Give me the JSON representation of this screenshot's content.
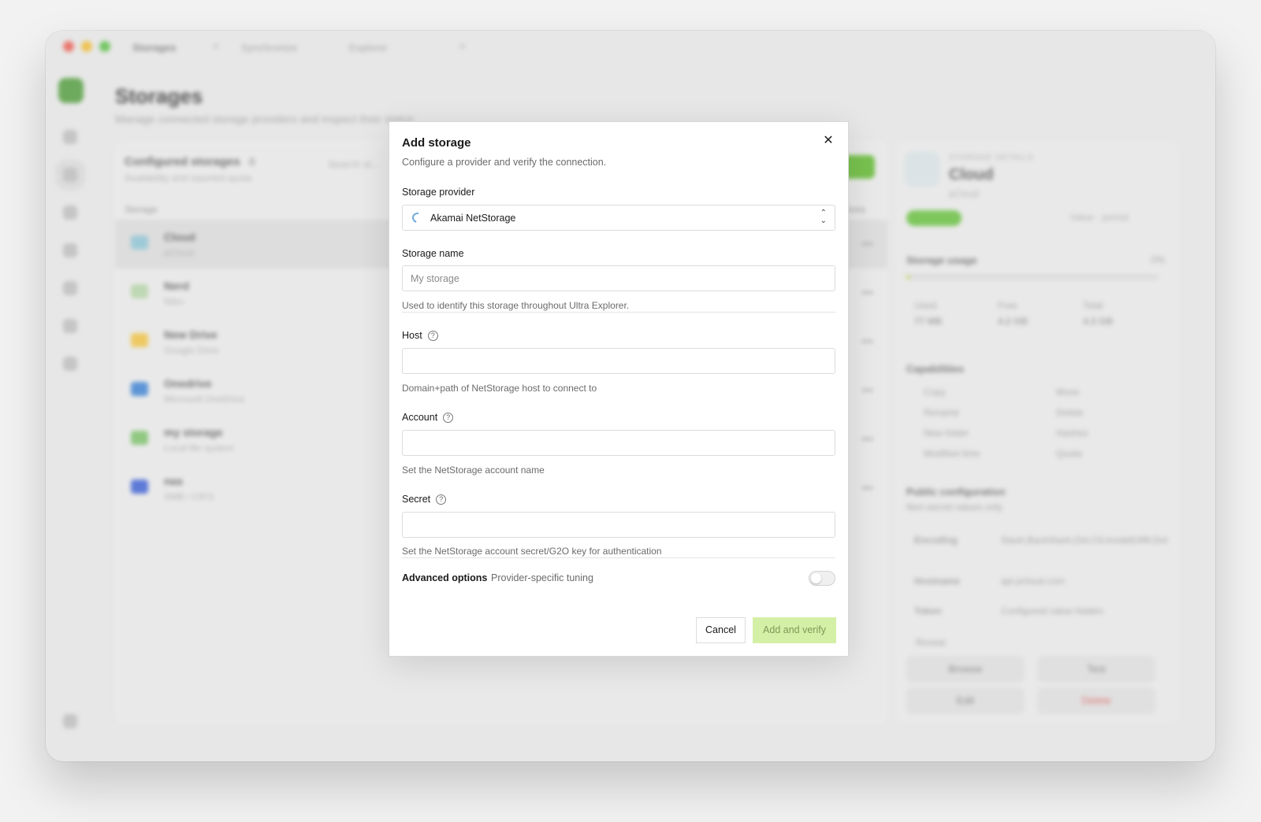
{
  "window": {
    "tabs": [
      "Storages",
      "Synchronize",
      "Explorer"
    ],
    "tab_close": "×"
  },
  "background": {
    "page_title": "Storages",
    "page_subtitle": "Manage connected storage providers and inspect their status",
    "list": {
      "title": "Configured storages",
      "count": "6",
      "subtitle": "Availability and reported quota",
      "search_placeholder": "Search st...",
      "col_storage": "Storage",
      "col_actions": "Actions",
      "rows": [
        {
          "name": "Cloud",
          "sub": "pCloud",
          "color": "#8ec6d8"
        },
        {
          "name": "Nerd",
          "sub": "Nitro",
          "color": "#b7d7a8"
        },
        {
          "name": "New Drive",
          "sub": "Google Drive",
          "color": "#f4c542"
        },
        {
          "name": "Onedrive",
          "sub": "Microsoft OneDrive",
          "color": "#3b82d6"
        },
        {
          "name": "my storage",
          "sub": "Local file system",
          "color": "#7cc36a"
        },
        {
          "name": "nas",
          "sub": "SMB / CIFS",
          "color": "#3a5fd6"
        }
      ],
      "row_menu": "•••"
    },
    "detail": {
      "eyebrow": "STORAGE DETAILS",
      "name": "Cloud",
      "sub": "pCloud",
      "meta": "Value · period",
      "usage_title": "Storage usage",
      "usage_pct": "0%",
      "usage_fraction": 0.01,
      "stats": [
        {
          "label": "Used",
          "value": "77 MB"
        },
        {
          "label": "Free",
          "value": "4.2 GB"
        },
        {
          "label": "Total",
          "value": "4.3 GB"
        }
      ],
      "cap_title": "Capabilities",
      "caps": [
        "Copy",
        "Move",
        "Rename",
        "Delete",
        "New folder",
        "Hashes",
        "Modified time",
        "Quota"
      ],
      "pub_title": "Public configuration",
      "pub_sub": "Non-secret values only",
      "pub_rows": [
        {
          "k": "Encoding",
          "v": "Slash,BackSlash,Del,Ctl,InvalidUtf8,Dot"
        },
        {
          "k": "Hostname",
          "v": "api.pcloud.com"
        },
        {
          "k": "Token",
          "v": "Configured value hidden"
        }
      ],
      "reveal": "Reveal",
      "actions": [
        "Browse",
        "Test",
        "Edit",
        "Delete"
      ]
    }
  },
  "modal": {
    "title": "Add storage",
    "subtitle": "Configure a provider and verify the connection.",
    "close_label": "✕",
    "provider": {
      "label": "Storage provider",
      "value": "Akamai NetStorage"
    },
    "name": {
      "label": "Storage name",
      "placeholder": "My storage",
      "value": "",
      "hint": "Used to identify this storage throughout Ultra Explorer."
    },
    "host": {
      "label": "Host",
      "value": "",
      "hint": "Domain+path of NetStorage host to connect to"
    },
    "account": {
      "label": "Account",
      "value": "",
      "hint": "Set the NetStorage account name"
    },
    "secret": {
      "label": "Secret",
      "value": "",
      "hint": "Set the NetStorage account secret/G2O key for authentication"
    },
    "help_glyph": "?",
    "advanced": {
      "label": "Advanced options",
      "sub": "Provider-specific tuning",
      "enabled": false
    },
    "cancel_label": "Cancel",
    "submit_label": "Add and verify",
    "accent": "#d4f0a6"
  }
}
